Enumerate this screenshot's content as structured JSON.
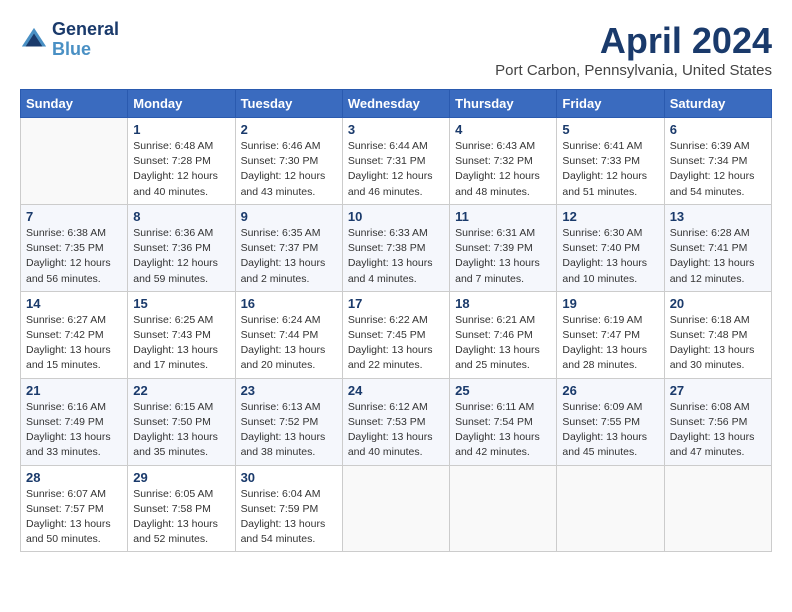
{
  "header": {
    "logo_line1": "General",
    "logo_line2": "Blue",
    "title": "April 2024",
    "subtitle": "Port Carbon, Pennsylvania, United States"
  },
  "calendar": {
    "days_of_week": [
      "Sunday",
      "Monday",
      "Tuesday",
      "Wednesday",
      "Thursday",
      "Friday",
      "Saturday"
    ],
    "weeks": [
      [
        {
          "day": "",
          "sunrise": "",
          "sunset": "",
          "daylight": ""
        },
        {
          "day": "1",
          "sunrise": "Sunrise: 6:48 AM",
          "sunset": "Sunset: 7:28 PM",
          "daylight": "Daylight: 12 hours and 40 minutes."
        },
        {
          "day": "2",
          "sunrise": "Sunrise: 6:46 AM",
          "sunset": "Sunset: 7:30 PM",
          "daylight": "Daylight: 12 hours and 43 minutes."
        },
        {
          "day": "3",
          "sunrise": "Sunrise: 6:44 AM",
          "sunset": "Sunset: 7:31 PM",
          "daylight": "Daylight: 12 hours and 46 minutes."
        },
        {
          "day": "4",
          "sunrise": "Sunrise: 6:43 AM",
          "sunset": "Sunset: 7:32 PM",
          "daylight": "Daylight: 12 hours and 48 minutes."
        },
        {
          "day": "5",
          "sunrise": "Sunrise: 6:41 AM",
          "sunset": "Sunset: 7:33 PM",
          "daylight": "Daylight: 12 hours and 51 minutes."
        },
        {
          "day": "6",
          "sunrise": "Sunrise: 6:39 AM",
          "sunset": "Sunset: 7:34 PM",
          "daylight": "Daylight: 12 hours and 54 minutes."
        }
      ],
      [
        {
          "day": "7",
          "sunrise": "Sunrise: 6:38 AM",
          "sunset": "Sunset: 7:35 PM",
          "daylight": "Daylight: 12 hours and 56 minutes."
        },
        {
          "day": "8",
          "sunrise": "Sunrise: 6:36 AM",
          "sunset": "Sunset: 7:36 PM",
          "daylight": "Daylight: 12 hours and 59 minutes."
        },
        {
          "day": "9",
          "sunrise": "Sunrise: 6:35 AM",
          "sunset": "Sunset: 7:37 PM",
          "daylight": "Daylight: 13 hours and 2 minutes."
        },
        {
          "day": "10",
          "sunrise": "Sunrise: 6:33 AM",
          "sunset": "Sunset: 7:38 PM",
          "daylight": "Daylight: 13 hours and 4 minutes."
        },
        {
          "day": "11",
          "sunrise": "Sunrise: 6:31 AM",
          "sunset": "Sunset: 7:39 PM",
          "daylight": "Daylight: 13 hours and 7 minutes."
        },
        {
          "day": "12",
          "sunrise": "Sunrise: 6:30 AM",
          "sunset": "Sunset: 7:40 PM",
          "daylight": "Daylight: 13 hours and 10 minutes."
        },
        {
          "day": "13",
          "sunrise": "Sunrise: 6:28 AM",
          "sunset": "Sunset: 7:41 PM",
          "daylight": "Daylight: 13 hours and 12 minutes."
        }
      ],
      [
        {
          "day": "14",
          "sunrise": "Sunrise: 6:27 AM",
          "sunset": "Sunset: 7:42 PM",
          "daylight": "Daylight: 13 hours and 15 minutes."
        },
        {
          "day": "15",
          "sunrise": "Sunrise: 6:25 AM",
          "sunset": "Sunset: 7:43 PM",
          "daylight": "Daylight: 13 hours and 17 minutes."
        },
        {
          "day": "16",
          "sunrise": "Sunrise: 6:24 AM",
          "sunset": "Sunset: 7:44 PM",
          "daylight": "Daylight: 13 hours and 20 minutes."
        },
        {
          "day": "17",
          "sunrise": "Sunrise: 6:22 AM",
          "sunset": "Sunset: 7:45 PM",
          "daylight": "Daylight: 13 hours and 22 minutes."
        },
        {
          "day": "18",
          "sunrise": "Sunrise: 6:21 AM",
          "sunset": "Sunset: 7:46 PM",
          "daylight": "Daylight: 13 hours and 25 minutes."
        },
        {
          "day": "19",
          "sunrise": "Sunrise: 6:19 AM",
          "sunset": "Sunset: 7:47 PM",
          "daylight": "Daylight: 13 hours and 28 minutes."
        },
        {
          "day": "20",
          "sunrise": "Sunrise: 6:18 AM",
          "sunset": "Sunset: 7:48 PM",
          "daylight": "Daylight: 13 hours and 30 minutes."
        }
      ],
      [
        {
          "day": "21",
          "sunrise": "Sunrise: 6:16 AM",
          "sunset": "Sunset: 7:49 PM",
          "daylight": "Daylight: 13 hours and 33 minutes."
        },
        {
          "day": "22",
          "sunrise": "Sunrise: 6:15 AM",
          "sunset": "Sunset: 7:50 PM",
          "daylight": "Daylight: 13 hours and 35 minutes."
        },
        {
          "day": "23",
          "sunrise": "Sunrise: 6:13 AM",
          "sunset": "Sunset: 7:52 PM",
          "daylight": "Daylight: 13 hours and 38 minutes."
        },
        {
          "day": "24",
          "sunrise": "Sunrise: 6:12 AM",
          "sunset": "Sunset: 7:53 PM",
          "daylight": "Daylight: 13 hours and 40 minutes."
        },
        {
          "day": "25",
          "sunrise": "Sunrise: 6:11 AM",
          "sunset": "Sunset: 7:54 PM",
          "daylight": "Daylight: 13 hours and 42 minutes."
        },
        {
          "day": "26",
          "sunrise": "Sunrise: 6:09 AM",
          "sunset": "Sunset: 7:55 PM",
          "daylight": "Daylight: 13 hours and 45 minutes."
        },
        {
          "day": "27",
          "sunrise": "Sunrise: 6:08 AM",
          "sunset": "Sunset: 7:56 PM",
          "daylight": "Daylight: 13 hours and 47 minutes."
        }
      ],
      [
        {
          "day": "28",
          "sunrise": "Sunrise: 6:07 AM",
          "sunset": "Sunset: 7:57 PM",
          "daylight": "Daylight: 13 hours and 50 minutes."
        },
        {
          "day": "29",
          "sunrise": "Sunrise: 6:05 AM",
          "sunset": "Sunset: 7:58 PM",
          "daylight": "Daylight: 13 hours and 52 minutes."
        },
        {
          "day": "30",
          "sunrise": "Sunrise: 6:04 AM",
          "sunset": "Sunset: 7:59 PM",
          "daylight": "Daylight: 13 hours and 54 minutes."
        },
        {
          "day": "",
          "sunrise": "",
          "sunset": "",
          "daylight": ""
        },
        {
          "day": "",
          "sunrise": "",
          "sunset": "",
          "daylight": ""
        },
        {
          "day": "",
          "sunrise": "",
          "sunset": "",
          "daylight": ""
        },
        {
          "day": "",
          "sunrise": "",
          "sunset": "",
          "daylight": ""
        }
      ]
    ]
  }
}
